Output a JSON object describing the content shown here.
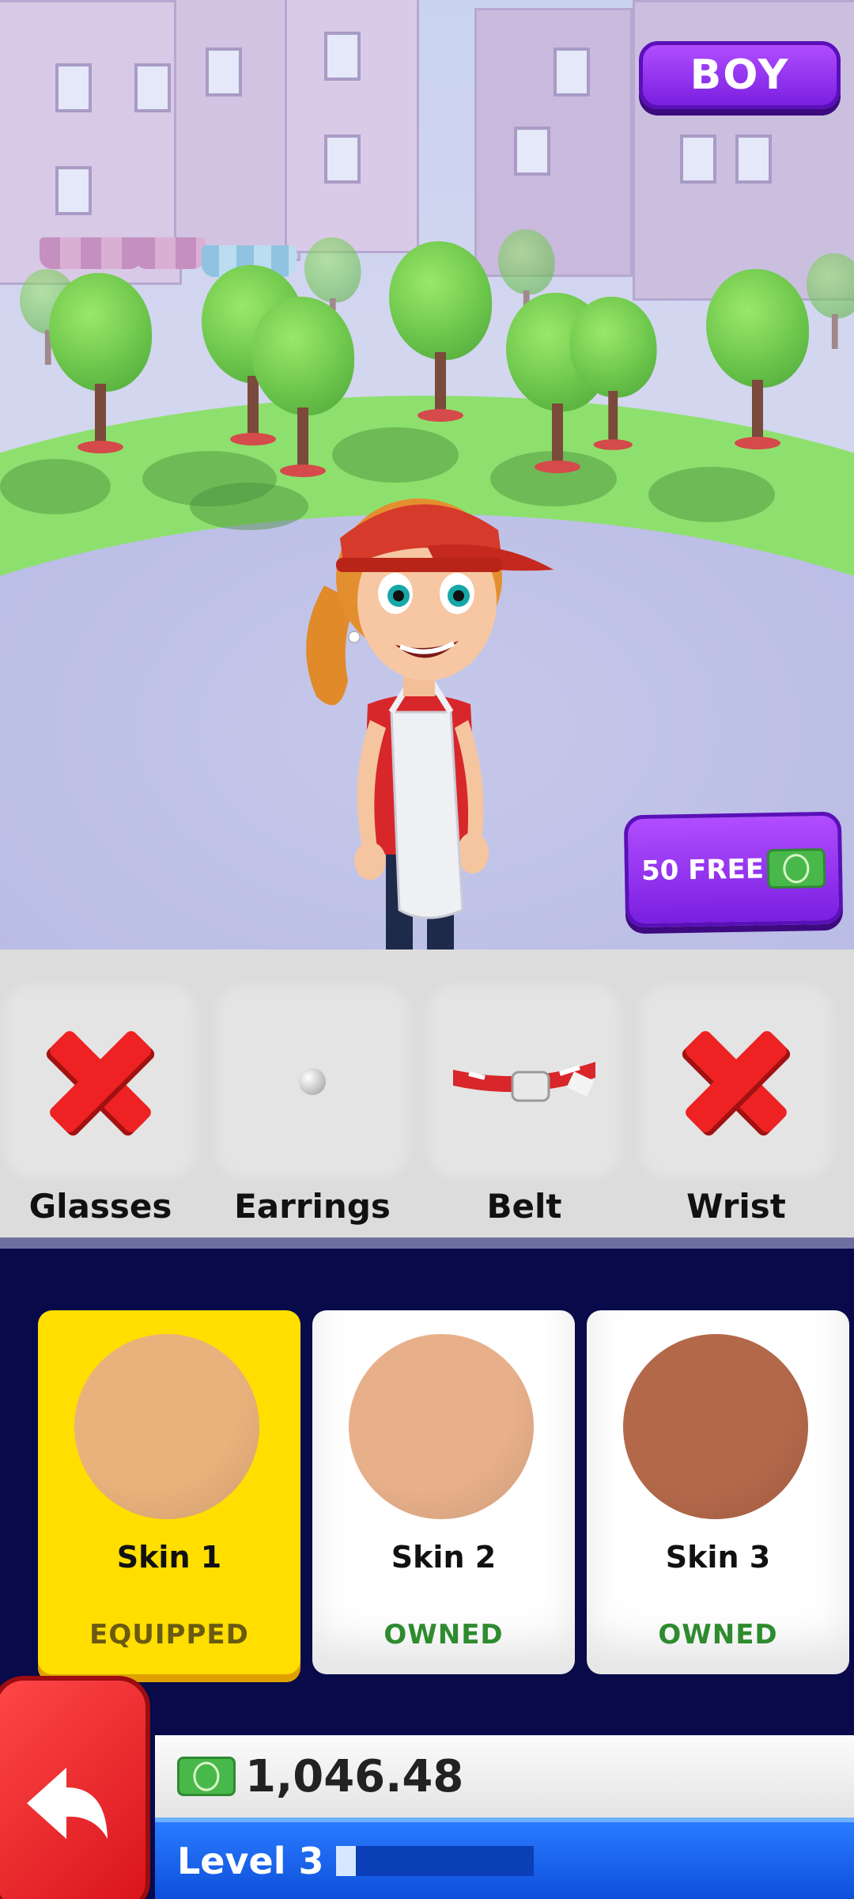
{
  "header": {
    "gender_button_label": "BOY"
  },
  "promo": {
    "free_cash_label": "50 FREE",
    "icon": "cash-icon"
  },
  "accessories": [
    {
      "label": "Glasses",
      "state": "none",
      "icon": "red-x-icon"
    },
    {
      "label": "Earrings",
      "state": "equipped",
      "icon": "pearl-earring-icon"
    },
    {
      "label": "Belt",
      "state": "equipped",
      "icon": "belt-icon"
    },
    {
      "label": "Wrist",
      "state": "none",
      "icon": "red-x-icon"
    }
  ],
  "skins": [
    {
      "name": "Skin 1",
      "status": "EQUIPPED",
      "color": "#e9b27c",
      "status_color": "#6b5a12"
    },
    {
      "name": "Skin 2",
      "status": "OWNED",
      "color": "#e8b08a",
      "status_color": "#2e8b2e"
    },
    {
      "name": "Skin 3",
      "status": "OWNED",
      "color": "#b4684a",
      "status_color": "#2e8b2e"
    }
  ],
  "footer": {
    "money": "1,046.48",
    "level_label": "Level 3",
    "level_progress": 0.1
  },
  "colors": {
    "accent_purple": "#9b30ff",
    "equipped_yellow": "#ffde00",
    "back_red": "#ee2a2a",
    "level_blue": "#1a62f0"
  }
}
